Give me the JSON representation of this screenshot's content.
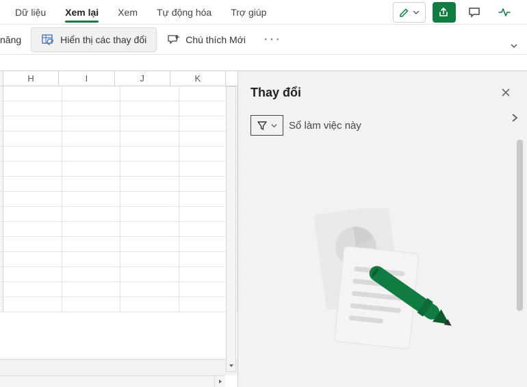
{
  "tabs": {
    "data": "Dữ liệu",
    "review": "Xem lại",
    "view": "Xem",
    "automate": "Tự động hóa",
    "help": "Trợ giúp"
  },
  "ribbon": {
    "perf_partial": " năng",
    "show_changes": "Hiển thị các thay đổi",
    "new_comment": "Chú thích Mới"
  },
  "grid": {
    "columns": [
      "H",
      "I",
      "J",
      "K"
    ]
  },
  "panel": {
    "title": "Thay đổi",
    "filter_scope": "Sổ làm việc này"
  }
}
